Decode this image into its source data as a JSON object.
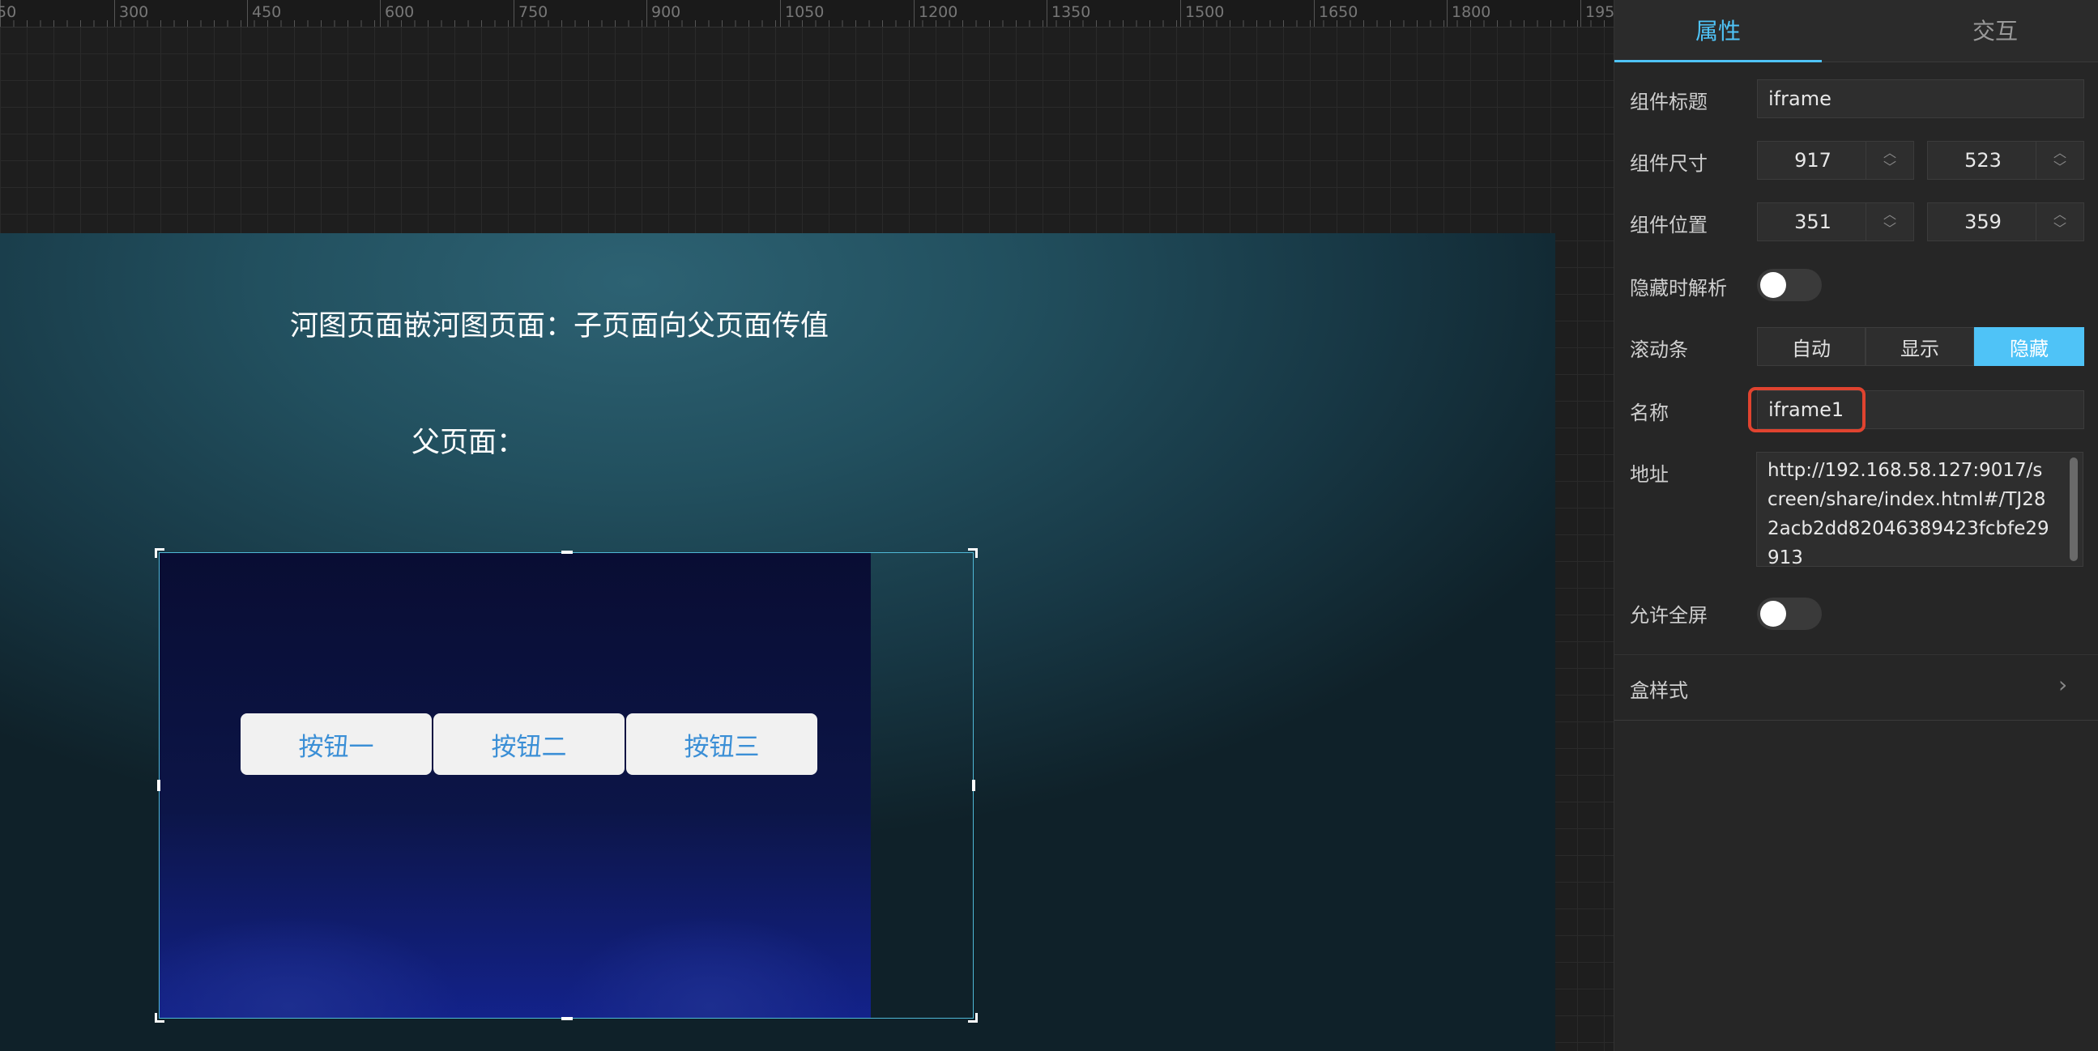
{
  "ruler": {
    "ticks": [
      "50",
      "300",
      "450",
      "600",
      "750",
      "900",
      "1050",
      "1200",
      "1350",
      "1500",
      "1650",
      "1800",
      "195"
    ]
  },
  "stage": {
    "title": "河图页面嵌河图页面：子页面向父页面传值",
    "parent_label": "父页面：",
    "iframe_buttons": [
      "按钮一",
      "按钮二",
      "按钮三"
    ]
  },
  "panel": {
    "tabs": {
      "attributes": "属性",
      "interaction": "交互"
    },
    "component_title": {
      "label": "组件标题",
      "value": "iframe"
    },
    "component_size": {
      "label": "组件尺寸",
      "width": "917",
      "height": "523"
    },
    "component_position": {
      "label": "组件位置",
      "x": "351",
      "y": "359"
    },
    "parse_when_hidden": {
      "label": "隐藏时解析",
      "on": false
    },
    "scrollbar": {
      "label": "滚动条",
      "options": [
        "自动",
        "显示",
        "隐藏"
      ],
      "selected": "隐藏"
    },
    "name": {
      "label": "名称",
      "value": "iframe1"
    },
    "address": {
      "label": "地址",
      "value": "http://192.168.58.127:9017/screen/share/index.html#/TJ282acb2dd82046389423fcbfe29913"
    },
    "allow_fullscreen": {
      "label": "允许全屏",
      "on": false
    },
    "box_style": {
      "label": "盒样式"
    },
    "accent_color": "#4fc3f7",
    "highlight_color": "#e0432f"
  }
}
